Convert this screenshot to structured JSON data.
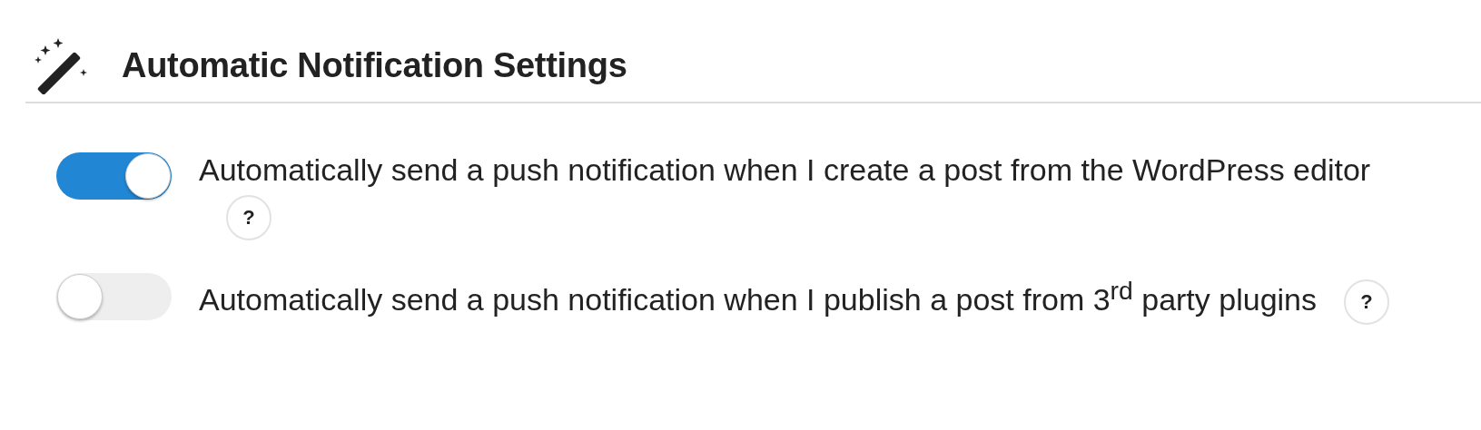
{
  "section": {
    "title": "Automatic Notification Settings"
  },
  "settings": [
    {
      "label": "Automatically send a push notification when I create a post from the WordPress editor",
      "on": true,
      "help": "?"
    },
    {
      "label": "Automatically send a push notification when I publish a post from 3$^{rd}$ party plugins",
      "on": false,
      "help": "?"
    }
  ]
}
